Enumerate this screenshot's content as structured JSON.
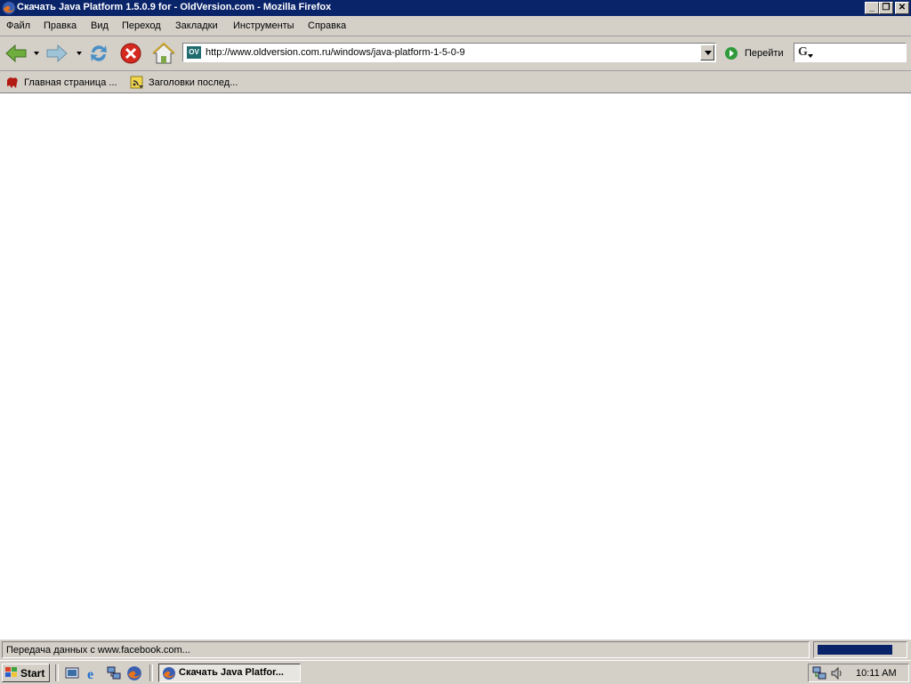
{
  "window": {
    "title": "Скачать Java Platform 1.5.0.9 for - OldVersion.com - Mozilla Firefox",
    "controls": [
      "minimize",
      "restore",
      "close"
    ]
  },
  "menu": {
    "items": [
      "Файл",
      "Правка",
      "Вид",
      "Переход",
      "Закладки",
      "Инструменты",
      "Справка"
    ]
  },
  "toolbar": {
    "url": "http://www.oldversion.com.ru/windows/java-platform-1-5-0-9",
    "site_icon_text": "OV",
    "go_label": "Перейти",
    "search_engine_icon": "G"
  },
  "bookmarks": [
    {
      "label": "Главная страница ...",
      "icon": "bookmark-red-icon"
    },
    {
      "label": "Заголовки послед...",
      "icon": "rss-feed-icon"
    }
  ],
  "status": {
    "text": "Передача данных с www.facebook.com...",
    "progress": 0.88
  },
  "taskbar": {
    "start_label": "Start",
    "task_label": "Скачать Java Platfor...",
    "clock": "10:11 AM"
  },
  "colors": {
    "titlebar": "#0a246a",
    "chrome": "#d4d0c8",
    "content": "#ffffff"
  }
}
